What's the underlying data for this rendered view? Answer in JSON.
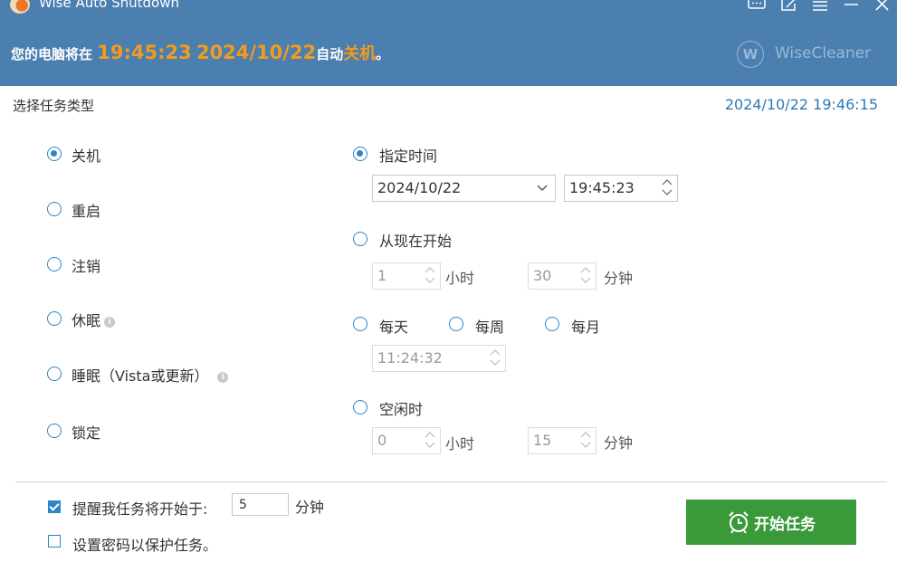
{
  "window": {
    "title": "Wise Auto Shutdown",
    "icons": [
      "feedback-icon",
      "edit-icon",
      "menu-icon",
      "minimize-icon",
      "close-icon"
    ]
  },
  "banner": {
    "prefix": "您的电脑将在",
    "time": "19:45:23",
    "date": "2024/10/22",
    "middle": "自动",
    "action": "关机",
    "suffix": "。"
  },
  "brand": {
    "mark": "W",
    "name": "WiseCleaner"
  },
  "task_section_label": "选择任务类型",
  "current_time": "2024/10/22 19:46:15",
  "task_types": [
    {
      "label": "关机",
      "selected": true
    },
    {
      "label": "重启",
      "selected": false
    },
    {
      "label": "注销",
      "selected": false
    },
    {
      "label": "休眠",
      "selected": false,
      "info": true
    },
    {
      "label": "睡眠（Vista或更新）",
      "selected": false,
      "info": true
    },
    {
      "label": "锁定",
      "selected": false
    }
  ],
  "schedule": {
    "specified": {
      "label": "指定时间",
      "selected": true,
      "date": "2024/10/22",
      "time": "19:45:23"
    },
    "from_now": {
      "label": "从现在开始",
      "selected": false,
      "hours": "1",
      "hours_unit": "小时",
      "minutes": "30",
      "minutes_unit": "分钟"
    },
    "daily": {
      "label": "每天",
      "selected": false
    },
    "weekly": {
      "label": "每周",
      "selected": false
    },
    "monthly": {
      "label": "每月",
      "selected": false
    },
    "recurring_time": "11:24:32",
    "idle": {
      "label": "空闲时",
      "selected": false,
      "hours": "0",
      "hours_unit": "小时",
      "minutes": "15",
      "minutes_unit": "分钟"
    }
  },
  "options": {
    "remind": {
      "label": "提醒我任务将开始于:",
      "checked": true,
      "value": "5",
      "unit": "分钟"
    },
    "password": {
      "label": "设置密码以保护任务。",
      "checked": false
    }
  },
  "start_button": {
    "label": "开始任务",
    "icon": "alarm-clock-icon"
  },
  "colors": {
    "header": "#4a7fb0",
    "accent": "#f39a1f",
    "primary": "#2a86c8",
    "button": "#3a9a3a",
    "clock": "#2a7ab8"
  }
}
